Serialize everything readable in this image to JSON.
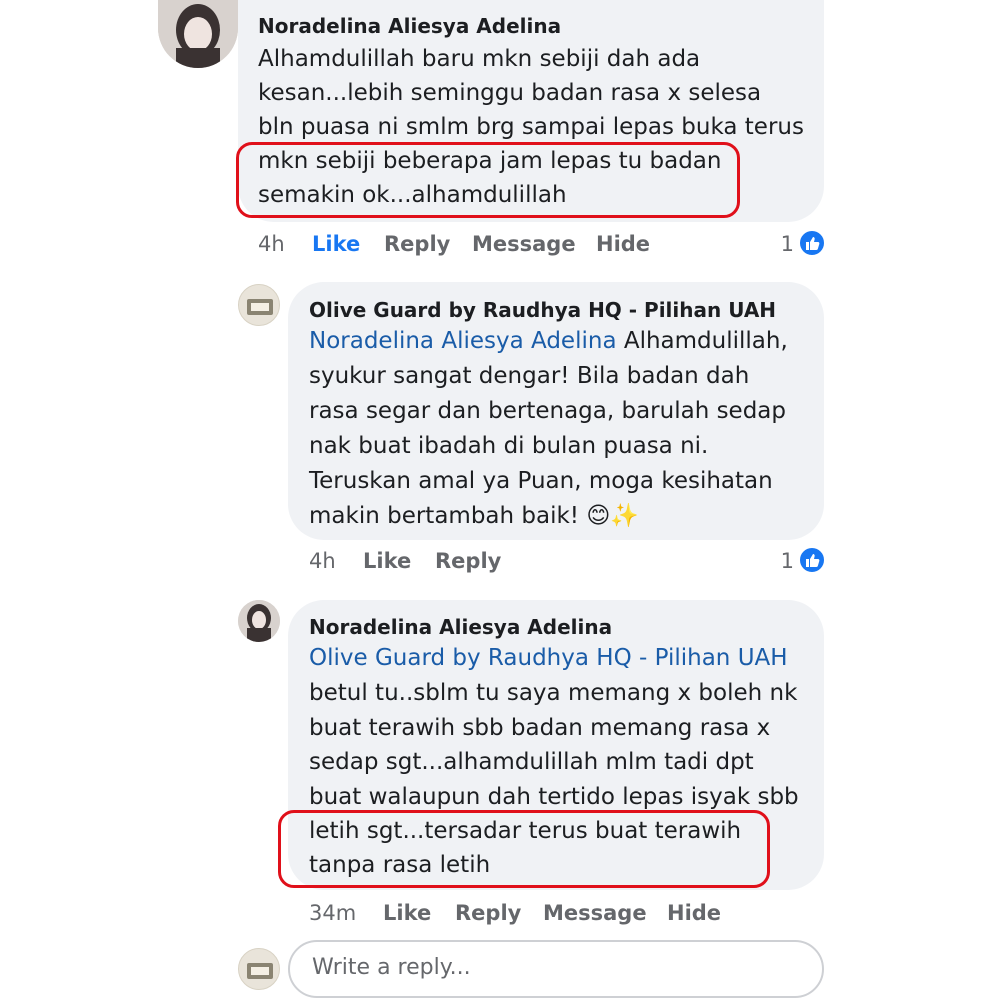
{
  "comments": [
    {
      "author": "Noradelina Aliesya Adelina",
      "lines": [
        "Alhamdulillah baru mkn sebiji dah ada",
        "kesan...lebih seminggu badan rasa x selesa",
        "bln puasa ni smlm brg sampai lepas buka terus",
        "mkn sebiji beberapa jam lepas tu badan",
        "semakin ok...alhamdulillah"
      ],
      "time": "4h",
      "actions": [
        "Like",
        "Reply",
        "Message",
        "Hide"
      ],
      "reaction_count": "1"
    },
    {
      "author": "Olive Guard by Raudhya HQ - Pilihan UAH",
      "mention": "Noradelina Aliesya Adelina",
      "first_line_rest": " Alhamdulillah,",
      "lines": [
        "syukur sangat dengar! Bila badan dah",
        "rasa segar dan bertenaga, barulah sedap",
        "nak buat ibadah di bulan puasa ni.",
        "Teruskan amal ya Puan, moga kesihatan",
        "makin bertambah baik! 😊✨"
      ],
      "time": "4h",
      "actions": [
        "Like",
        "Reply"
      ],
      "reaction_count": "1"
    },
    {
      "author": "Noradelina Aliesya Adelina",
      "mention": "Olive Guard by Raudhya HQ - Pilihan UAH",
      "lines": [
        "betul tu..sblm tu saya memang x boleh nk",
        "buat terawih sbb badan memang rasa x",
        "sedap sgt...alhamdulillah mlm tadi dpt",
        "buat walaupun dah tertido lepas isyak sbb",
        "letih sgt...tersadar terus buat terawih",
        "tanpa rasa letih"
      ],
      "time": "34m",
      "actions": [
        "Like",
        "Reply",
        "Message",
        "Hide"
      ]
    }
  ],
  "reply_box": {
    "placeholder": "Write a reply..."
  },
  "colors": {
    "accent": "#1877f2",
    "highlight": "#e0101a",
    "bubble": "#f0f2f5",
    "mention": "#1a5ca8"
  },
  "icons": [
    "like-reaction-icon",
    "avatar",
    "page-avatar"
  ]
}
